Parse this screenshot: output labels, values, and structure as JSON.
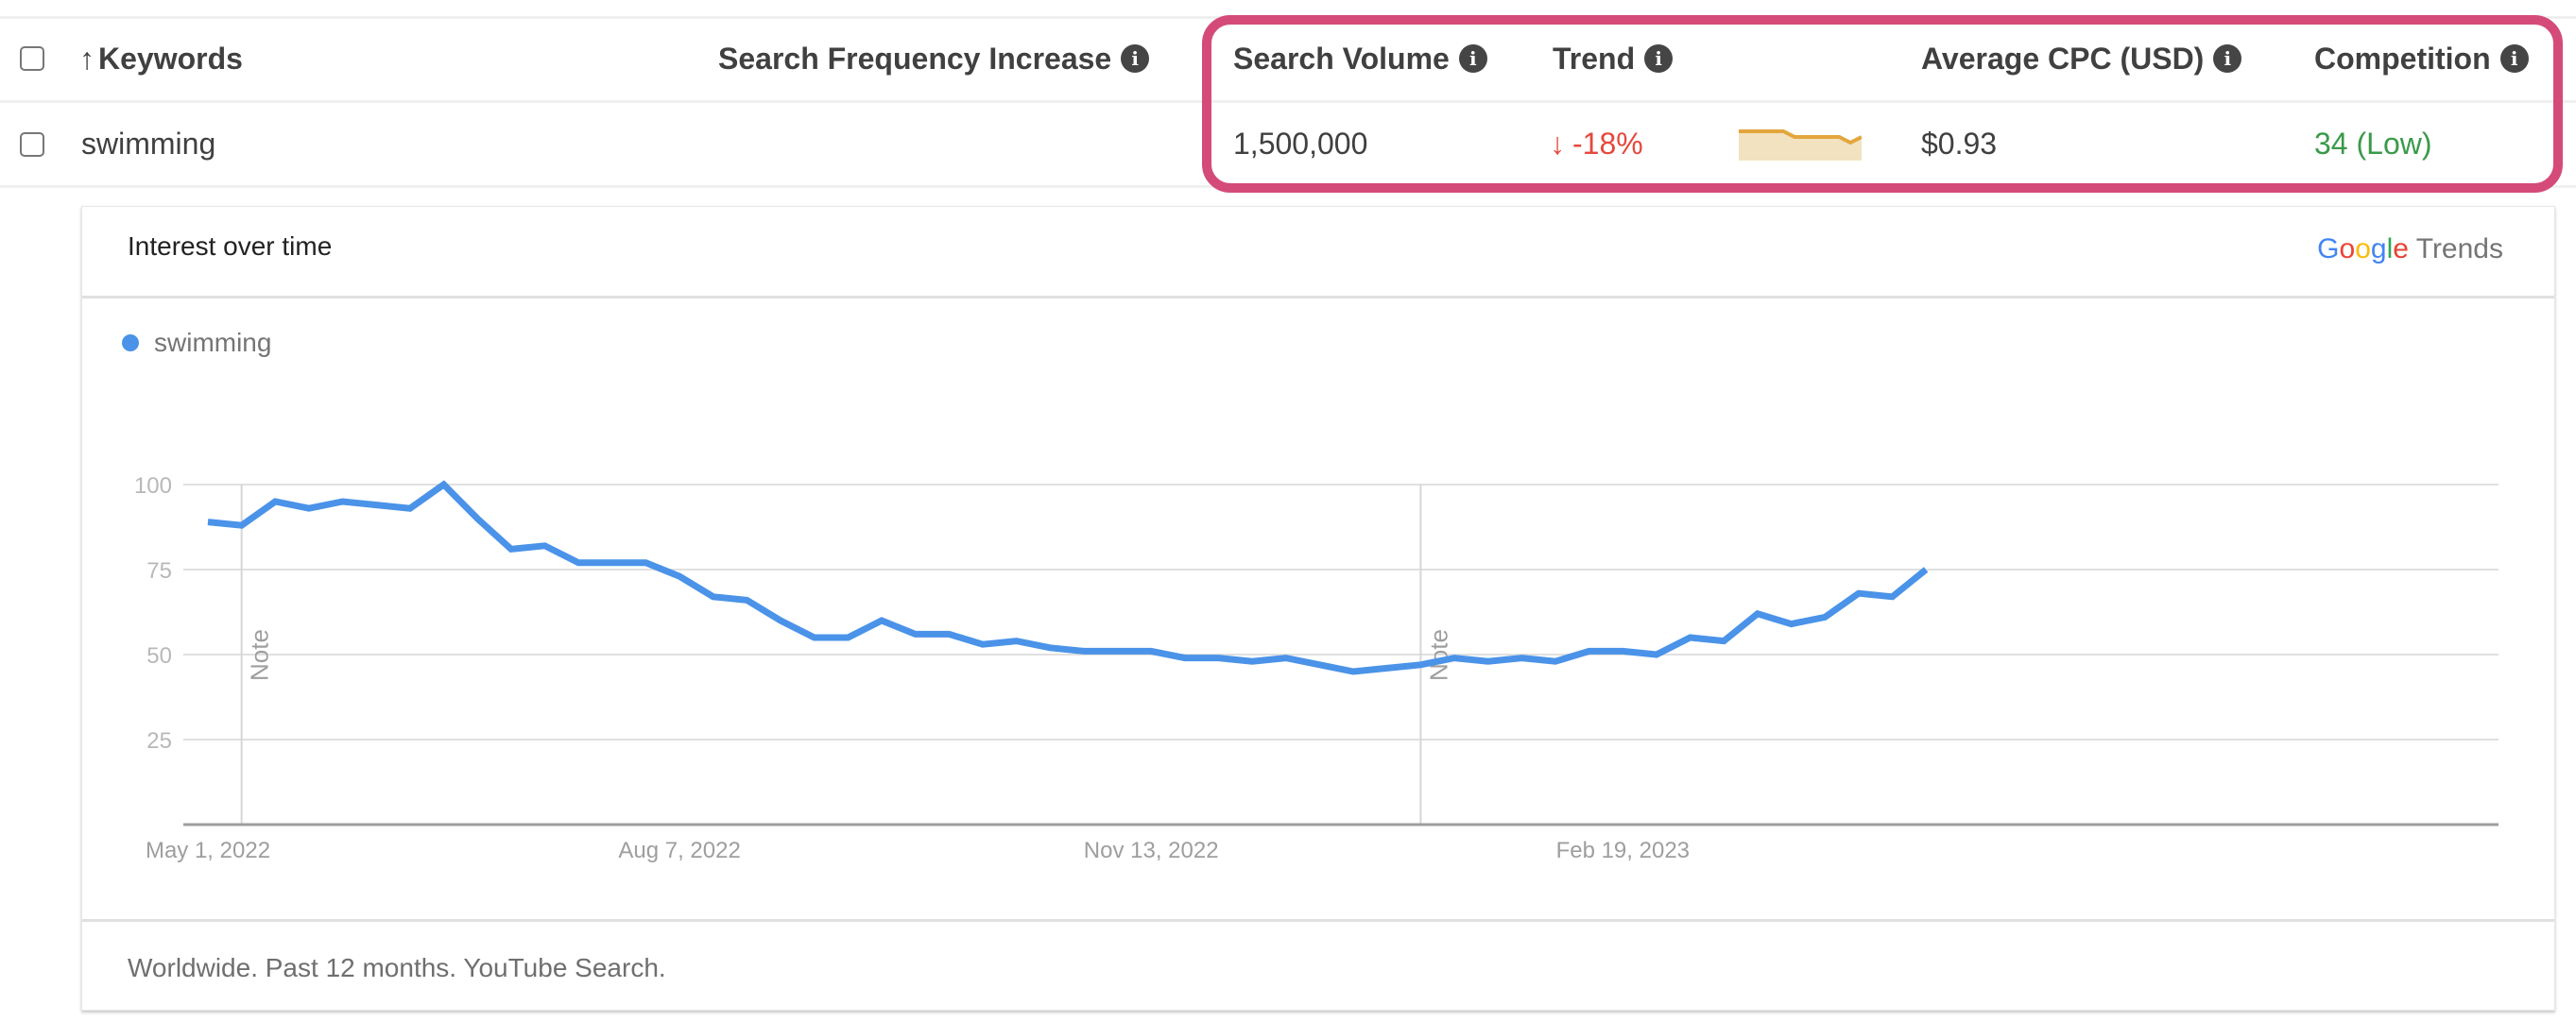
{
  "table": {
    "columns": {
      "keywords": "Keywords",
      "search_frequency_increase": "Search Frequency Increase",
      "search_volume": "Search Volume",
      "trend": "Trend",
      "average_cpc": "Average CPC (USD)",
      "competition": "Competition"
    },
    "sort_icon": "arrow-up-icon",
    "info_icon_glyph": "i",
    "rows": [
      {
        "keyword": "swimming",
        "search_frequency_increase": "",
        "search_volume": "1,500,000",
        "trend_arrow": "↓",
        "trend_value": "-18%",
        "trend_sparkline": [
          100,
          100,
          100,
          100,
          100,
          96,
          96,
          96,
          96,
          96,
          92,
          96
        ],
        "average_cpc": "$0.93",
        "competition": "34 (Low)"
      }
    ]
  },
  "colors": {
    "highlight": "#d44b7a",
    "trend_down": "#e5483e",
    "competition_low": "#3a9a4a",
    "sparkline_line": "#e3a63d",
    "sparkline_fill": "#f3e2c0",
    "series": "#4a93e8"
  },
  "card": {
    "title": "Interest over time",
    "logo": {
      "google": [
        "G",
        "o",
        "o",
        "g",
        "l",
        "e"
      ],
      "google_colors": [
        "#4285F4",
        "#EA4335",
        "#FBBC05",
        "#4285F4",
        "#34A853",
        "#EA4335"
      ],
      "trends": "Trends"
    },
    "footer": "Worldwide. Past 12 months. YouTube Search."
  },
  "chart_data": {
    "type": "line",
    "title": "Interest over time",
    "xlabel": "",
    "ylabel": "",
    "ylim": [
      0,
      100
    ],
    "yticks": [
      25,
      50,
      75,
      100
    ],
    "grid": true,
    "legend_position": "top-left",
    "x_tick_labels": [
      {
        "label": "May 1, 2022",
        "index": 0
      },
      {
        "label": "Aug 7, 2022",
        "index": 14
      },
      {
        "label": "Nov 13, 2022",
        "index": 28
      },
      {
        "label": "Feb 19, 2023",
        "index": 42
      }
    ],
    "annotations": [
      {
        "text": "Note",
        "index": 1
      },
      {
        "text": "Note",
        "index": 36
      }
    ],
    "series": [
      {
        "name": "swimming",
        "color": "#4a93e8",
        "values": [
          89,
          88,
          95,
          93,
          95,
          94,
          93,
          100,
          90,
          81,
          82,
          77,
          77,
          77,
          73,
          67,
          66,
          60,
          55,
          55,
          60,
          56,
          56,
          53,
          54,
          52,
          51,
          51,
          51,
          49,
          49,
          48,
          49,
          47,
          45,
          46,
          47,
          49,
          48,
          49,
          48,
          51,
          51,
          50,
          55,
          54,
          62,
          59,
          61,
          68,
          67,
          75
        ]
      }
    ]
  }
}
